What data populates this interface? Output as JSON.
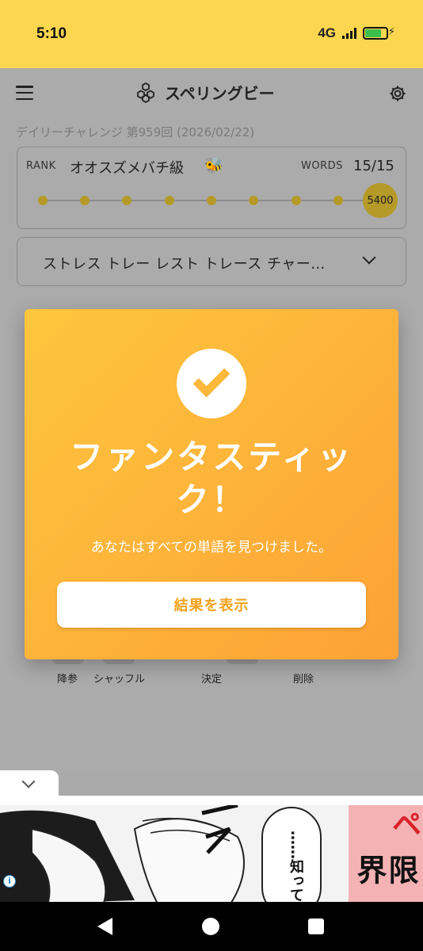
{
  "status": {
    "time": "5:10",
    "network": "4G"
  },
  "header": {
    "title": "スペリングビー",
    "menu_icon": "hamburger-icon",
    "logo_icon": "honeycomb-icon",
    "settings_icon": "gear-icon"
  },
  "challenge": {
    "subtitle": "デイリーチャレンジ 第959回 (2026/02/22)"
  },
  "rank_card": {
    "rank_label": "RANK",
    "rank_name": "オオスズメバチ級",
    "rank_emoji": "🐝",
    "words_label": "WORDS",
    "words_count": "15/15",
    "score": "5400",
    "progress_steps": 9,
    "current_step": 9
  },
  "found_words": {
    "text": "ストレス トレー レスト トレース チャー…"
  },
  "controls": {
    "give_up": "降参",
    "shuffle": "シャッフル",
    "enter": "決定",
    "delete": "削除"
  },
  "modal": {
    "title": "ファンタスティック！",
    "message": "あなたはすべての単語を見つけました。",
    "button_label": "結果を表示",
    "accent_color": "#fdb43a"
  },
  "ad": {
    "vertical_text_1": "ハイスペ",
    "vertical_text_2": "限界",
    "speech_text": "……知って",
    "info_label": "i"
  }
}
